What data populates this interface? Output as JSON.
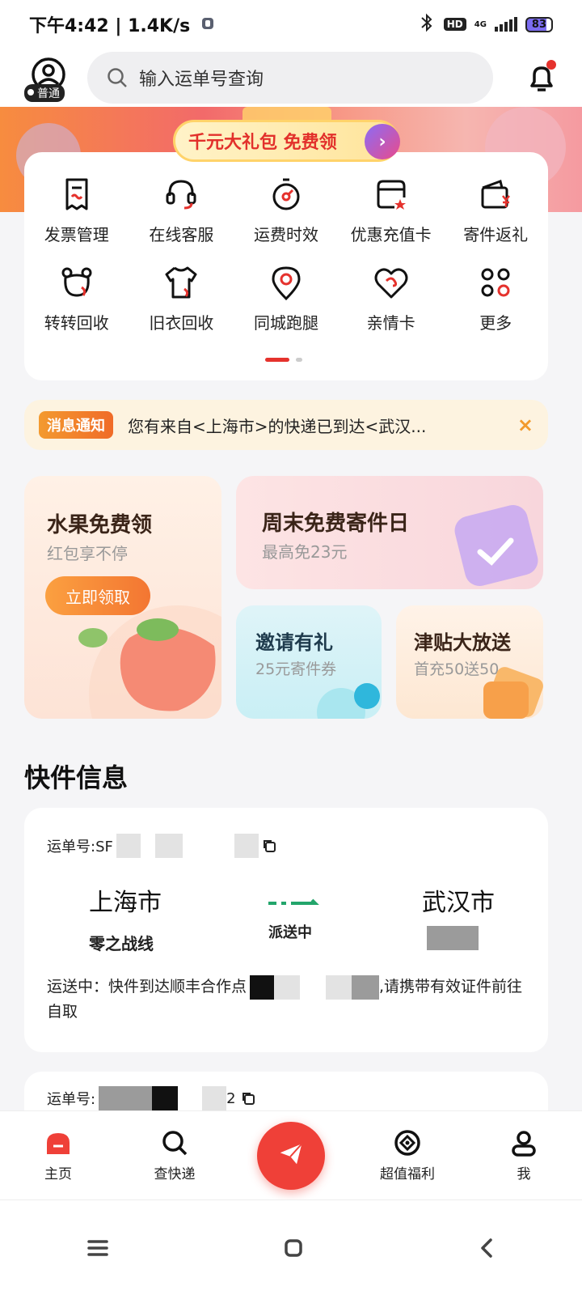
{
  "status_bar": {
    "time": "下午4:42 | 1.4K/s",
    "hd": "HD",
    "network": "4G",
    "battery": "83"
  },
  "header": {
    "badge": "普通",
    "search_placeholder": "输入运单号查询"
  },
  "banner": {
    "gift_text": "千元大礼包 免费领"
  },
  "services": [
    {
      "label": "发票管理",
      "icon": "invoice-icon"
    },
    {
      "label": "在线客服",
      "icon": "headset-icon"
    },
    {
      "label": "运费时效",
      "icon": "stopwatch-icon"
    },
    {
      "label": "优惠充值卡",
      "icon": "card-star-icon"
    },
    {
      "label": "寄件返礼",
      "icon": "wallet-yen-icon"
    },
    {
      "label": "转转回收",
      "icon": "bear-recycle-icon"
    },
    {
      "label": "旧衣回收",
      "icon": "shirt-icon"
    },
    {
      "label": "同城跑腿",
      "icon": "location-pin-icon"
    },
    {
      "label": "亲情卡",
      "icon": "heart-link-icon"
    },
    {
      "label": "更多",
      "icon": "more-grid-icon"
    }
  ],
  "notice": {
    "tag": "消息通知",
    "text": "您有来自<上海市>的快递已到达<武汉...",
    "close": "×"
  },
  "promos": {
    "fruit": {
      "title": "水果免费领",
      "subtitle": "红包享不停",
      "button": "立即领取"
    },
    "weekend": {
      "title": "周末免费寄件日",
      "subtitle": "最高免23元"
    },
    "invite": {
      "title": "邀请有礼",
      "subtitle": "25元寄件券"
    },
    "subsidy": {
      "title": "津贴大放送",
      "subtitle": "首充50送50"
    }
  },
  "section_title": "快件信息",
  "parcels": [
    {
      "waybill_label": "运单号:SF",
      "from_city": "上海市",
      "from_name": "零之战线",
      "status": "派送中",
      "to_city": "武汉市",
      "detail_prefix": "运送中：快件到达顺丰合作点",
      "detail_suffix": ",请携带有效证件前往自取"
    },
    {
      "waybill_label": "运单号:",
      "waybill_tail": "2"
    }
  ],
  "bottom_nav": [
    {
      "label": "主页",
      "icon": "home-icon"
    },
    {
      "label": "查快递",
      "icon": "search-icon"
    },
    {
      "label": "",
      "icon": "send-plane-icon"
    },
    {
      "label": "超值福利",
      "icon": "target-icon"
    },
    {
      "label": "我",
      "icon": "user-icon"
    }
  ],
  "colors": {
    "brand_red": "#ef4038",
    "accent_orange": "#f39a2f"
  }
}
